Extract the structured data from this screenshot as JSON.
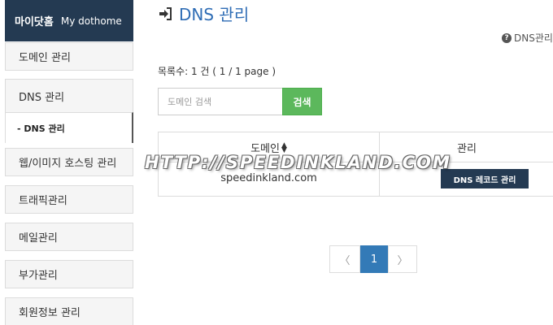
{
  "sidebar": {
    "header_ko": "마이닷홈",
    "header_en": "My dothome",
    "items": [
      {
        "label": "도메인 관리"
      },
      {
        "label": "웹/이미지 호스팅 관리"
      },
      {
        "label": "트래픽관리"
      },
      {
        "label": "메일관리"
      },
      {
        "label": "부가관리"
      },
      {
        "label": "회원정보 관리"
      }
    ],
    "dns_group": {
      "label": "DNS 관리",
      "sub_label": "- DNS 관리"
    }
  },
  "main": {
    "title": "DNS 관리",
    "help_link": "DNS관리",
    "count_text": "목록수: 1 건 ( 1 / 1 page )",
    "search": {
      "placeholder": "도메인 검색",
      "button_label": "검색"
    },
    "table": {
      "columns": [
        "도메인",
        "관리"
      ],
      "rows": [
        {
          "domain": "speedinkland.com",
          "action": "DNS 레코드 관리"
        }
      ]
    },
    "pagination": {
      "prev": "〈",
      "current": "1",
      "next": "〉"
    }
  },
  "watermark": "HTTP://SPEEDINKLAND.COM",
  "colors": {
    "sidebar_header": "#243a52",
    "title_blue": "#2f6db5",
    "search_green": "#5cb85c",
    "action_navy": "#243a52",
    "page_active": "#337ab7"
  }
}
